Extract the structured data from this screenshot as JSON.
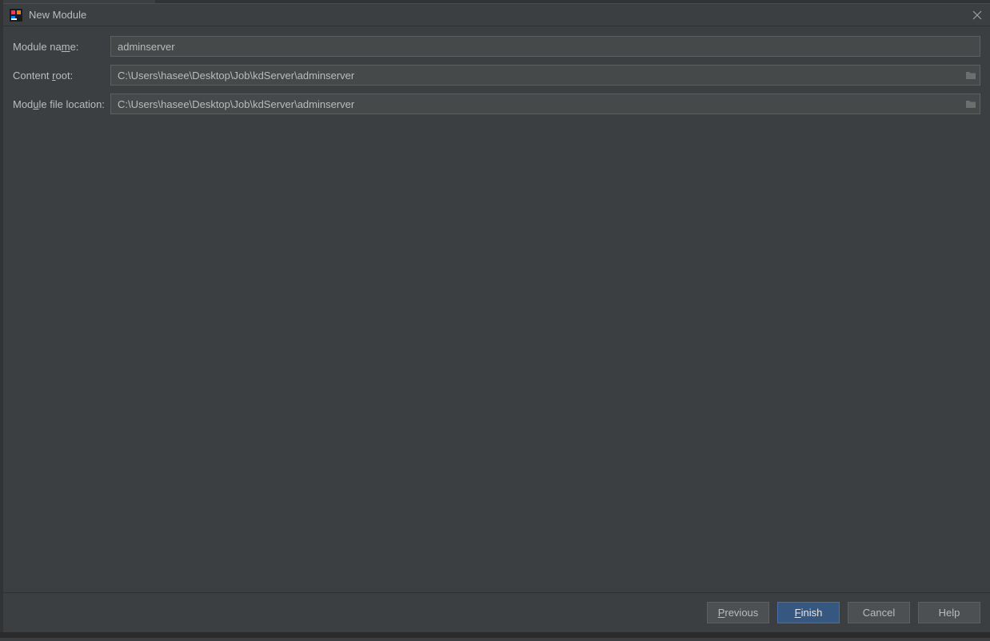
{
  "title": "New Module",
  "labels": {
    "module_name_pre": "Module na",
    "module_name_mn": "m",
    "module_name_post": "e:",
    "content_root_pre": "Content ",
    "content_root_mn": "r",
    "content_root_post": "oot:",
    "module_file_location_pre": "Mod",
    "module_file_location_mn": "u",
    "module_file_location_post": "le file location:"
  },
  "fields": {
    "module_name": "adminserver",
    "content_root": "C:\\Users\\hasee\\Desktop\\Job\\kdServer\\adminserver",
    "module_file_location": "C:\\Users\\hasee\\Desktop\\Job\\kdServer\\adminserver"
  },
  "buttons": {
    "previous_mn": "P",
    "previous_post": "revious",
    "finish_mn": "F",
    "finish_post": "inish",
    "cancel": "Cancel",
    "help": "Help"
  }
}
